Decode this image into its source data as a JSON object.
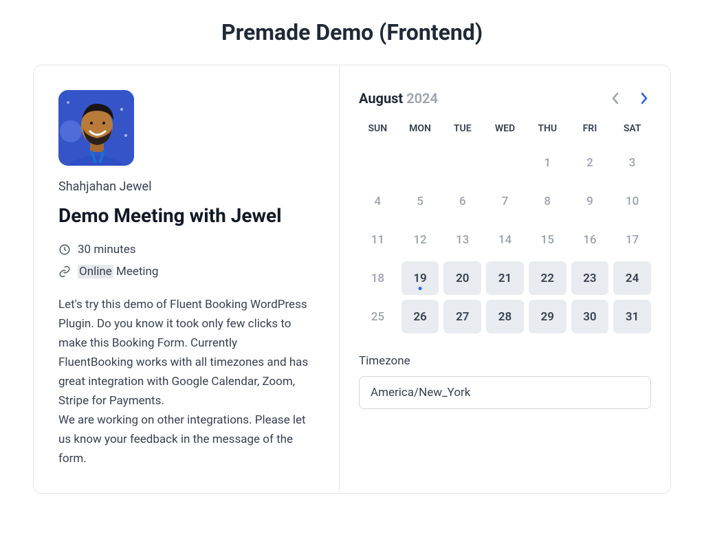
{
  "page": {
    "title": "Premade Demo (Frontend)"
  },
  "host": {
    "name": "Shahjahan Jewel",
    "meeting_title": "Demo Meeting with Jewel"
  },
  "meta": {
    "duration": "30 minutes",
    "location_hl": "Online",
    "location_rest": " Meeting"
  },
  "description": "Let's try this demo of Fluent Booking WordPress Plugin. Do you know it took only few clicks to make this Booking Form. Currently FluentBooking works with all timezones and has great integration with Google Calendar, Zoom, Stripe for Payments.\nWe are working on other integrations. Please let us know your feedback in the message of the form.",
  "calendar": {
    "month": "August",
    "year": "2024",
    "prev_enabled": false,
    "next_enabled": true,
    "dow": [
      "SUN",
      "MON",
      "TUE",
      "WED",
      "THU",
      "FRI",
      "SAT"
    ],
    "weeks": [
      [
        null,
        null,
        null,
        null,
        {
          "n": 1,
          "state": "past"
        },
        {
          "n": 2,
          "state": "past"
        },
        {
          "n": 3,
          "state": "past"
        }
      ],
      [
        {
          "n": 4,
          "state": "past"
        },
        {
          "n": 5,
          "state": "past"
        },
        {
          "n": 6,
          "state": "past"
        },
        {
          "n": 7,
          "state": "past"
        },
        {
          "n": 8,
          "state": "past"
        },
        {
          "n": 9,
          "state": "past"
        },
        {
          "n": 10,
          "state": "past"
        }
      ],
      [
        {
          "n": 11,
          "state": "past"
        },
        {
          "n": 12,
          "state": "past"
        },
        {
          "n": 13,
          "state": "past"
        },
        {
          "n": 14,
          "state": "past"
        },
        {
          "n": 15,
          "state": "past"
        },
        {
          "n": 16,
          "state": "past"
        },
        {
          "n": 17,
          "state": "past"
        }
      ],
      [
        {
          "n": 18,
          "state": "past"
        },
        {
          "n": 19,
          "state": "avail",
          "today": true
        },
        {
          "n": 20,
          "state": "avail"
        },
        {
          "n": 21,
          "state": "avail"
        },
        {
          "n": 22,
          "state": "avail"
        },
        {
          "n": 23,
          "state": "avail"
        },
        {
          "n": 24,
          "state": "avail"
        }
      ],
      [
        {
          "n": 25,
          "state": "past"
        },
        {
          "n": 26,
          "state": "avail"
        },
        {
          "n": 27,
          "state": "avail"
        },
        {
          "n": 28,
          "state": "avail"
        },
        {
          "n": 29,
          "state": "avail"
        },
        {
          "n": 30,
          "state": "avail"
        },
        {
          "n": 31,
          "state": "avail"
        }
      ]
    ]
  },
  "timezone": {
    "label": "Timezone",
    "value": "America/New_York"
  }
}
